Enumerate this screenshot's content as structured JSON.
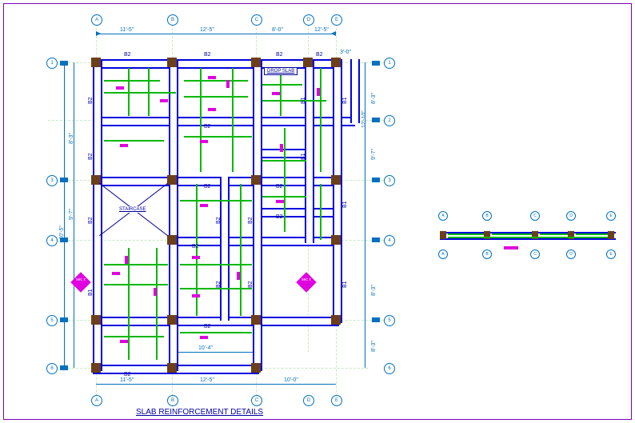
{
  "title": "SLAB REINFORCEMENT DETAILS",
  "grid": {
    "cols": [
      "A",
      "B",
      "C",
      "D",
      "E"
    ],
    "rows": [
      "1",
      "2",
      "3",
      "4",
      "5",
      "6"
    ]
  },
  "dims": {
    "top": {
      "AB": "11'-5\"",
      "BC": "12'-5\"",
      "CD": "8'-0\"",
      "DE": "12'-5\"",
      "right_ext": "3'-0\""
    },
    "bottom": {
      "AB": "11'-5\"",
      "BC": "12'-5\"",
      "CE": "10'-0\"",
      "C_D_mid": "10'-4\""
    },
    "left": {
      "r12": "8'-3\"",
      "r24": "9'-7\"",
      "total": "40'-5\""
    },
    "right": {
      "r12": "8'-3\"",
      "r23": "9'-7\"",
      "r45": "8'-3\"",
      "r56": "8'-3\"",
      "ext": "12'-10\""
    }
  },
  "labels": {
    "drop_slab": "DROP SLAB",
    "staircase": "STAIRCASE",
    "B1": "B1",
    "B2": "B2",
    "sec": "sec\nx"
  },
  "section": {
    "grids": [
      "A",
      "B",
      "C",
      "D",
      "E"
    ]
  }
}
